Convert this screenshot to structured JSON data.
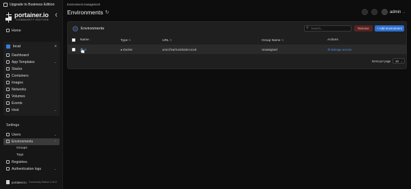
{
  "sidebar": {
    "upgrade_label": "Upgrade to Business Edition",
    "logo": {
      "brand": "portainer.io",
      "edition": "COMMUNITY EDITION"
    },
    "home_label": "Home",
    "environment": {
      "name": "local",
      "items": [
        "Dashboard",
        "App Templates",
        "Stacks",
        "Containers",
        "Images",
        "Networks",
        "Volumes",
        "Events",
        "Host"
      ]
    },
    "settings_title": "Settings",
    "settings_items": {
      "users": "Users",
      "environments": "Environments",
      "groups": "Groups",
      "tags": "Tags",
      "registries": "Registries",
      "auth_logs": "Authentication logs"
    },
    "footer": {
      "brand": "portainer.io",
      "edition": "Community Edition 2.16.0"
    }
  },
  "header": {
    "breadcrumb": "Environment management",
    "title": "Environments",
    "username": "admin"
  },
  "panel": {
    "title": "Environments",
    "search_placeholder": "Search...",
    "remove_label": "Remove",
    "add_label": "+ Add environment",
    "columns": {
      "name": "Name",
      "type": "Type",
      "url": "URL",
      "group": "Group Name",
      "actions": "Actions"
    },
    "rows": [
      {
        "name": "local",
        "type": "Docker",
        "url": "unix:///var/run/docker.sock",
        "group": "Unassigned",
        "action": "Manage access"
      }
    ],
    "pager_label": "Items per page",
    "pager_value": "10"
  },
  "colors": {
    "accent": "#2e6fd1",
    "danger": "#5a2323",
    "link": "#4f8fe0"
  }
}
